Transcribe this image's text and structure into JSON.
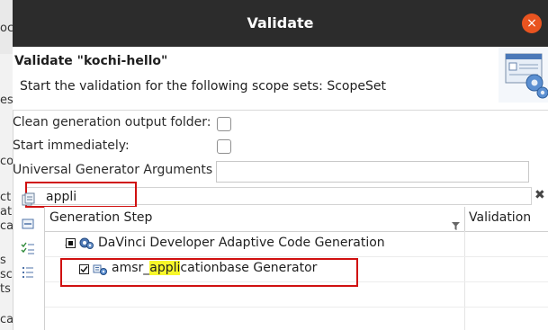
{
  "dialog": {
    "title": "Validate",
    "close_glyph": "×",
    "header_title": "Validate \"kochi-hello\"",
    "header_description": "Start the validation for the following scope sets: ScopeSet",
    "header_image_icon": "validation-banner-icon"
  },
  "background_fragments": [
    "oc",
    "es",
    "co",
    "ct",
    "at",
    "ca",
    "s",
    "sc",
    "ts",
    "ca"
  ],
  "options": {
    "clean_output_label": "Clean generation output folder:",
    "clean_output_checked": false,
    "start_immediately_label": "Start immediately:",
    "start_immediately_checked": false,
    "universal_args_label": "Universal Generator Arguments",
    "universal_args_value": ""
  },
  "filter": {
    "value": "appli",
    "clear_glyph": "✖"
  },
  "table": {
    "columns": [
      "Generation Step",
      "Validation"
    ],
    "rows": [
      {
        "expand_glyph": "◢",
        "checkbox_state": "partial",
        "label": "DaVinci Developer Adaptive Code Generation",
        "validation": ""
      },
      {
        "checkbox_state": "checked",
        "label_prefix": "amsr_",
        "label_match": "appli",
        "label_suffix": "cationbase Generator",
        "validation": ""
      }
    ]
  },
  "colors": {
    "titlebar": "#2c2c2c",
    "close_button": "#e95420",
    "annotation_red": "#d01010",
    "search_highlight": "#f7f72a"
  }
}
